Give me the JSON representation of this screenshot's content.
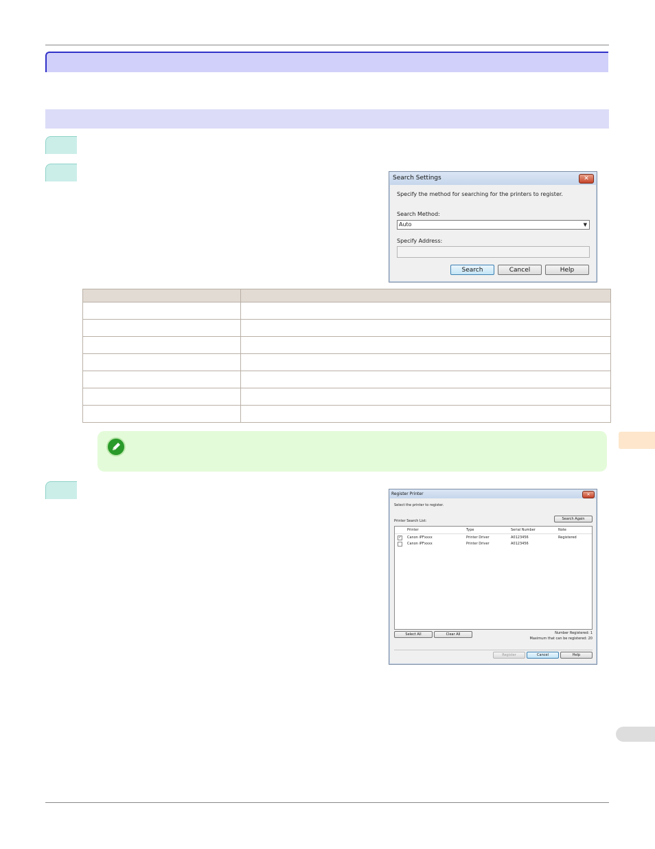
{
  "search_dialog": {
    "title": "Search Settings",
    "close_glyph": "✕",
    "instruction": "Specify the method for searching for the printers to register.",
    "method_label": "Search Method:",
    "method_value": "Auto",
    "address_label": "Specify Address:",
    "address_value": "",
    "search_button": "Search",
    "cancel_button": "Cancel",
    "help_button": "Help"
  },
  "register_dialog": {
    "title": "Register Printer",
    "close_glyph": "✕",
    "instruction": "Select the printer to register.",
    "list_label": "Printer Search List:",
    "search_again_button": "Search Again",
    "columns": [
      "Printer",
      "Type",
      "Serial Number",
      "Note"
    ],
    "rows": [
      {
        "checked": true,
        "printer": "Canon iPFxxxx",
        "type": "Printer Driver",
        "serial": "A0123456",
        "note": "Registered"
      },
      {
        "checked": false,
        "printer": "Canon iPFxxxx",
        "type": "Printer Driver",
        "serial": "A0123456",
        "note": ""
      }
    ],
    "select_all_button": "Select All",
    "clear_all_button": "Clear All",
    "number_registered": "Number Registered: 1",
    "max_registered": "Maximum that can be registered: 20",
    "register_button": "Register",
    "cancel_button": "Cancel",
    "help_button": "Help"
  },
  "check_glyph": "✓",
  "colors": {
    "title_bar": "#d0d0fa",
    "section_bar": "#dcdcf8",
    "step_badge": "#cbeee9",
    "note_bg": "#e4fbd9",
    "side_tab": "#fde6cc"
  }
}
